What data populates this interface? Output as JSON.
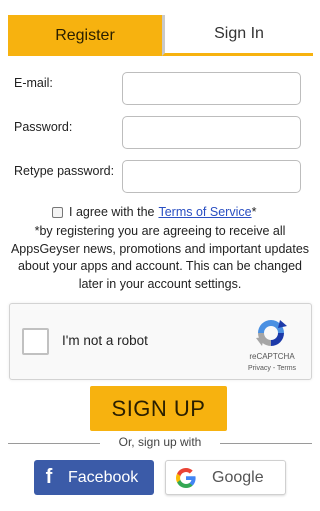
{
  "tabs": {
    "register": "Register",
    "sign_in": "Sign In"
  },
  "form": {
    "email_label": "E-mail:",
    "email_value": "",
    "password_label": "Password:",
    "password_value": "",
    "retype_label": "Retype password:",
    "retype_value": ""
  },
  "agree": {
    "checked": false,
    "text": "I agree with the",
    "link": "Terms of Service",
    "suffix": "*"
  },
  "disclaimer": "*by registering you are agreeing to receive all AppsGeyser news, promotions and important updates about your apps and account. This can be changed later in your account settings.",
  "recaptcha": {
    "checked": false,
    "label": "I'm not a robot",
    "brand": "reCAPTCHA",
    "terms": "Privacy - Terms"
  },
  "signup_button": "SIGN UP",
  "divider_text": "Or, sign up with",
  "social": {
    "facebook_icon": "f",
    "facebook": "Facebook",
    "google": "Google"
  },
  "colors": {
    "accent": "#f7b20f",
    "facebook": "#3b5ba8",
    "link": "#2a4fc2"
  },
  "icons": [
    "recaptcha-logo-icon",
    "google-logo-icon",
    "facebook-logo-icon"
  ]
}
